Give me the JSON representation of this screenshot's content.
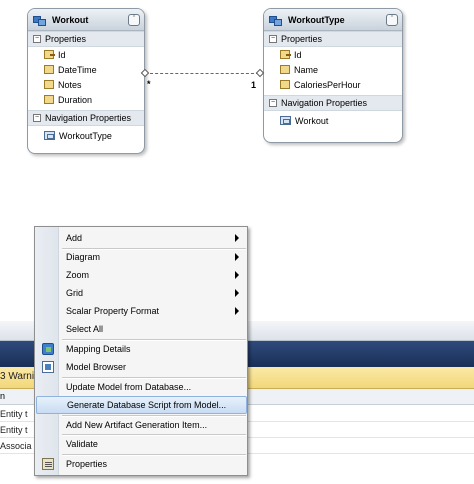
{
  "entities": [
    {
      "title": "Workout",
      "properties_label": "Properties",
      "properties": [
        "Id",
        "DateTime",
        "Notes",
        "Duration"
      ],
      "nav_label": "Navigation Properties",
      "nav_properties": [
        "WorkoutType"
      ]
    },
    {
      "title": "WorkoutType",
      "properties_label": "Properties",
      "properties": [
        "Id",
        "Name",
        "CaloriesPerHour"
      ],
      "nav_label": "Navigation Properties",
      "nav_properties": [
        "Workout"
      ]
    }
  ],
  "association": {
    "left_multiplicity": "*",
    "right_multiplicity": "1"
  },
  "background": {
    "warning_text": "3 Warni",
    "header_text": "n",
    "rows": [
      "Entity t",
      "Entity t",
      "Associa"
    ]
  },
  "context_menu": {
    "items": [
      {
        "label": "Add",
        "submenu": true
      },
      {
        "label": "Diagram",
        "submenu": true
      },
      {
        "label": "Zoom",
        "submenu": true
      },
      {
        "label": "Grid",
        "submenu": true
      },
      {
        "label": "Scalar Property Format",
        "submenu": true
      },
      {
        "label": "Select All"
      },
      {
        "label": "Mapping Details",
        "icon": "mapping-details-icon"
      },
      {
        "label": "Model Browser",
        "icon": "model-browser-icon"
      },
      {
        "label": "Update Model from Database..."
      },
      {
        "label": "Generate Database Script from Model...",
        "highlighted": true
      },
      {
        "label": "Add New Artifact Generation Item..."
      },
      {
        "label": "Validate"
      },
      {
        "label": "Properties",
        "icon": "properties-icon"
      }
    ]
  },
  "colors": {
    "entity_header": "#c9d3dc",
    "menu_highlight": "#c8dcf3",
    "dark_band": "#1a2f57",
    "warning_band": "#f2d77a"
  }
}
